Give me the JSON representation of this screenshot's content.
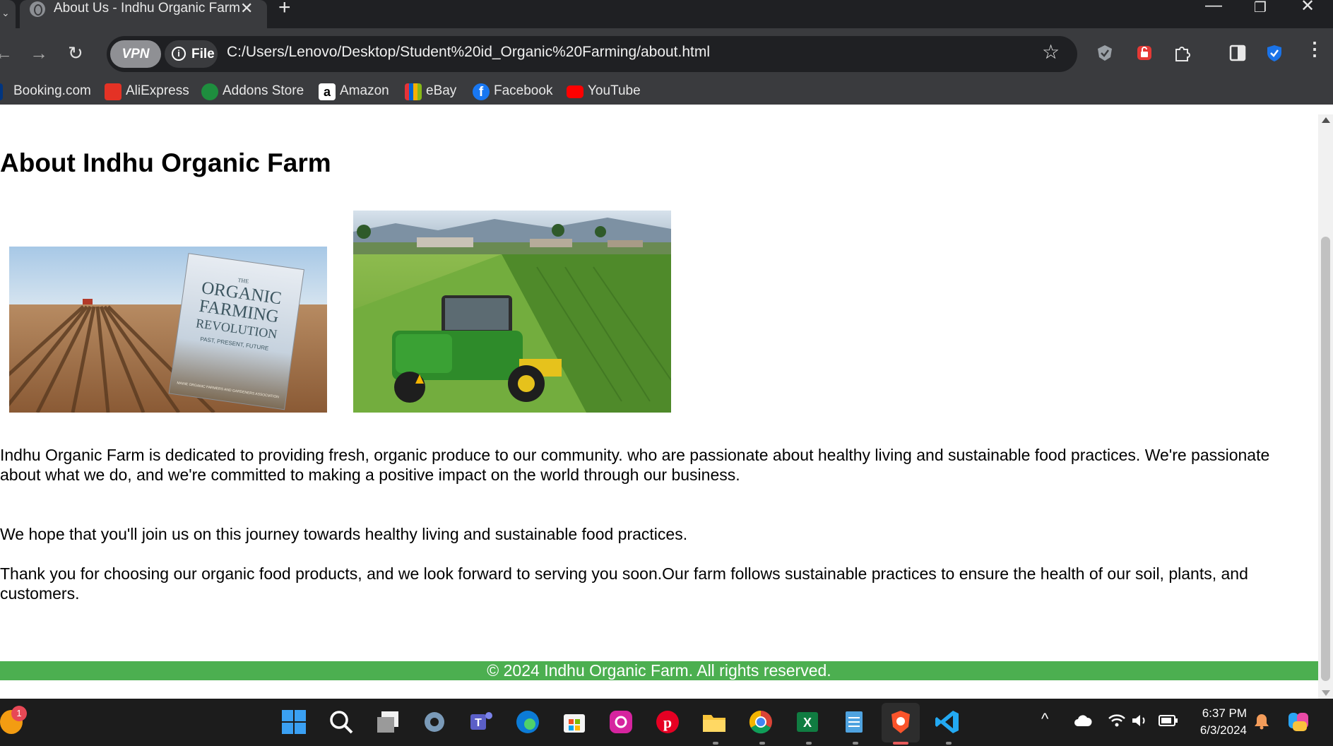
{
  "browser": {
    "tab": {
      "title": "About Us - Indhu Organic Farm",
      "close_glyph": "✕"
    },
    "new_tab_glyph": "+",
    "window_controls": {
      "minimize": "—",
      "restore": "❐",
      "close": "✕"
    },
    "nav": {
      "back": "←",
      "forward": "→",
      "reload": "↻"
    },
    "vpn_label": "VPN",
    "site_info": {
      "icon": "i",
      "label": "File"
    },
    "url": "C:/Users/Lenovo/Desktop/Student%20id_Organic%20Farming/about.html",
    "bookmark_star": "☆",
    "bookmarks": [
      {
        "label": "Booking.com",
        "icon": "booking-icon",
        "color": "#003580"
      },
      {
        "label": "AliExpress",
        "icon": "aliexpress-icon",
        "color": "#e43225"
      },
      {
        "label": "Addons Store",
        "icon": "addons-store-icon",
        "color": "#1e8e3e"
      },
      {
        "label": "Amazon",
        "icon": "amazon-icon",
        "color": "#ffffff"
      },
      {
        "label": "eBay",
        "icon": "ebay-icon",
        "color": "#0064d2"
      },
      {
        "label": "Facebook",
        "icon": "facebook-icon",
        "color": "#1877f2"
      },
      {
        "label": "YouTube",
        "icon": "youtube-icon",
        "color": "#ff0000"
      }
    ]
  },
  "page": {
    "title": "About Indhu Organic Farm",
    "image_1": {
      "book_the": "THE",
      "book_title_1": "ORGANIC",
      "book_title_2": "FARMING",
      "book_title_3": "REVOLUTION",
      "book_subtitle": "PAST, PRESENT, FUTURE",
      "book_publisher": "MAINE ORGANIC FARMERS AND GARDENERS ASSOCIATION"
    },
    "paragraphs": [
      "Indhu Organic Farm is dedicated to providing fresh, organic produce to our community. who are passionate about healthy living and sustainable food practices. We're passionate about what we do, and we're committed to making a positive impact on the world through our business.",
      "We hope that you'll join us on this journey towards healthy living and sustainable food practices.",
      "Thank you for choosing our organic food products, and we look forward to serving you soon.Our farm follows sustainable practices to ensure the health of our soil, plants, and customers."
    ],
    "footer": "© 2024 Indhu Organic Farm. All rights reserved.",
    "footer_color": "#4caf50"
  },
  "taskbar": {
    "notification_badge": "1",
    "apps": [
      "windows-start-icon",
      "search-icon",
      "task-view-icon",
      "settings-icon",
      "teams-icon",
      "edge-icon",
      "store-icon",
      "instagram-icon",
      "pinterest-icon",
      "file-explorer-icon",
      "chrome-icon",
      "excel-icon",
      "notepad-icon",
      "brave-browser-icon",
      "vscode-icon"
    ],
    "time": "6:37 PM",
    "date": "6/3/2024"
  }
}
